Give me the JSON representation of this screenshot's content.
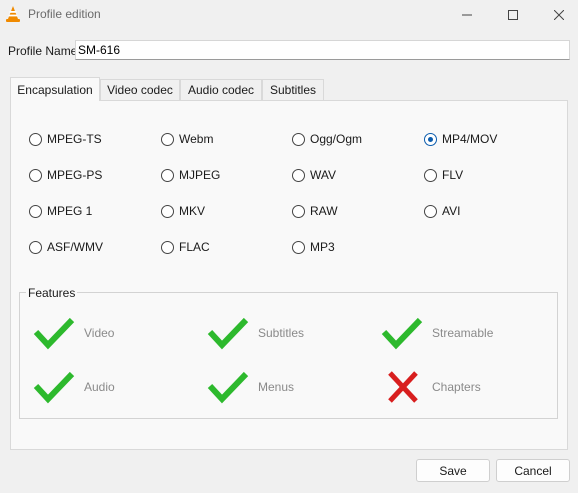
{
  "window": {
    "title": "Profile edition"
  },
  "profile": {
    "label": "Profile Name",
    "value": "SM-616"
  },
  "tabs": [
    {
      "label": "Encapsulation",
      "active": true
    },
    {
      "label": "Video codec",
      "active": false
    },
    {
      "label": "Audio codec",
      "active": false
    },
    {
      "label": "Subtitles",
      "active": false
    }
  ],
  "encapsulation": {
    "options": [
      "MPEG-TS",
      "Webm",
      "Ogg/Ogm",
      "MP4/MOV",
      "MPEG-PS",
      "MJPEG",
      "WAV",
      "FLV",
      "MPEG 1",
      "MKV",
      "RAW",
      "AVI",
      "ASF/WMV",
      "FLAC",
      "MP3"
    ],
    "selected": "MP4/MOV"
  },
  "features": {
    "title": "Features",
    "items": [
      {
        "label": "Video",
        "enabled": true
      },
      {
        "label": "Subtitles",
        "enabled": true
      },
      {
        "label": "Streamable",
        "enabled": true
      },
      {
        "label": "Audio",
        "enabled": true
      },
      {
        "label": "Menus",
        "enabled": true
      },
      {
        "label": "Chapters",
        "enabled": false
      }
    ]
  },
  "buttons": {
    "save": "Save",
    "cancel": "Cancel"
  },
  "colors": {
    "check": "#2db92d",
    "cross": "#d81e1e",
    "radio_selected": "#0b5cad",
    "vlc_orange": "#f08a00"
  }
}
